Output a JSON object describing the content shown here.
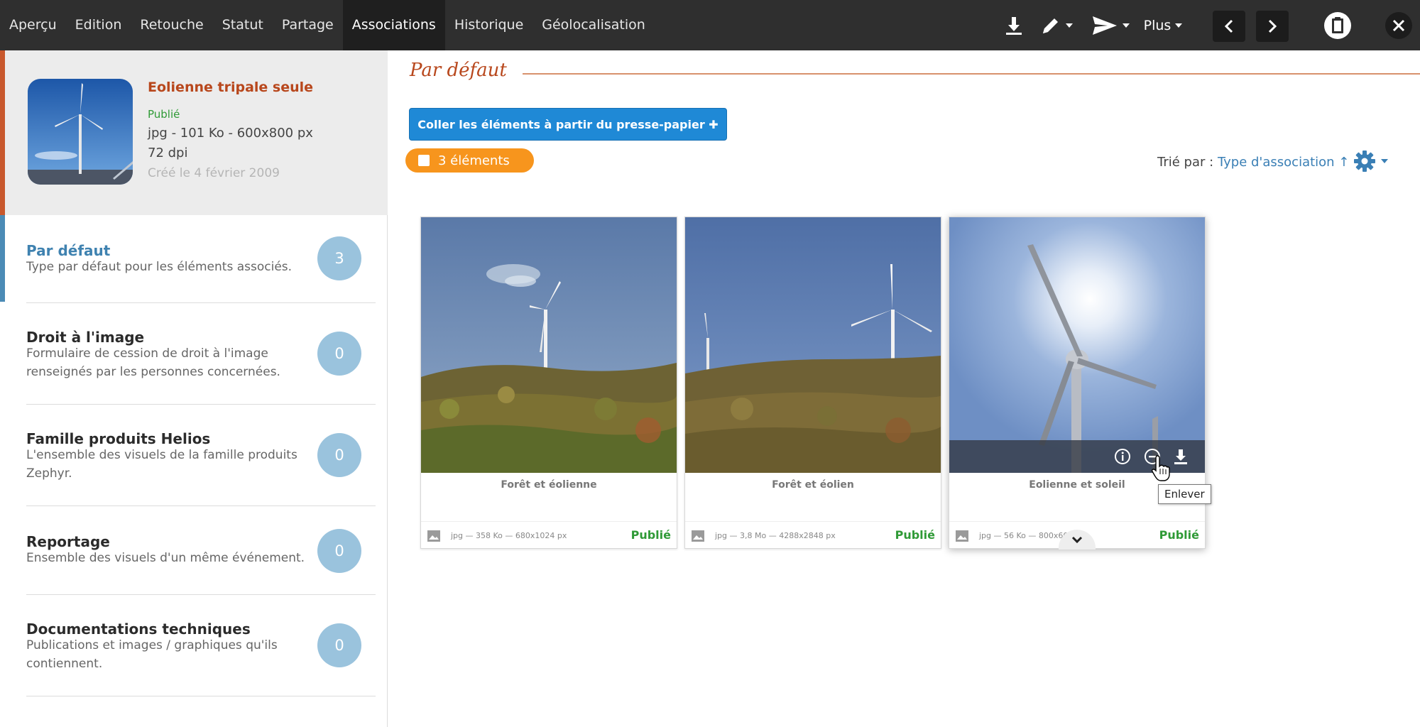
{
  "topbar": {
    "tabs": [
      {
        "label": "Aperçu"
      },
      {
        "label": "Edition"
      },
      {
        "label": "Retouche"
      },
      {
        "label": "Statut"
      },
      {
        "label": "Partage"
      },
      {
        "label": "Associations",
        "active": true
      },
      {
        "label": "Historique"
      },
      {
        "label": "Géolocalisation"
      }
    ],
    "more_label": "Plus",
    "icons": [
      "download-icon",
      "pencil-icon",
      "send-icon",
      "chevron-left-icon",
      "chevron-right-icon",
      "clipboard-icon",
      "close-icon"
    ]
  },
  "asset": {
    "title": "Eolienne tripale seule",
    "status": "Publié",
    "meta_format": "jpg - 101 Ko - 600x800 px",
    "meta_dpi": "72 dpi",
    "created": "Créé le 4 février 2009"
  },
  "categories": [
    {
      "name": "Par défaut",
      "desc": "Type par défaut pour les éléments associés.",
      "count": "3",
      "active": true
    },
    {
      "name": "Droit à l'image",
      "desc": "Formulaire de cession de droit à l'image renseignés par les personnes concernées.",
      "count": "0"
    },
    {
      "name": "Famille produits Helios",
      "desc": "L'ensemble des visuels de la famille produits Zephyr.",
      "count": "0"
    },
    {
      "name": "Reportage",
      "desc": "Ensemble des visuels d'un même événement.",
      "count": "0"
    },
    {
      "name": "Documentations techniques",
      "desc": "Publications et images / graphiques qu'ils contiennent.",
      "count": "0"
    }
  ],
  "main": {
    "section_title": "Par défaut",
    "paste_button": "Coller les éléments à partir du presse-papier ✚",
    "count_label": "3 éléments",
    "sort_prefix": "Trié par :",
    "sort_value": "Type d'association ↑"
  },
  "cards": [
    {
      "title": "Forêt et éolienne",
      "meta": "jpg — 358 Ko — 680x1024 px",
      "status": "Publié"
    },
    {
      "title": "Forêt et éolien",
      "meta": "jpg — 3,8 Mo — 4288x2848 px",
      "status": "Publié"
    },
    {
      "title": "Eolienne et soleil",
      "meta": "jpg — 56 Ko — 800x600 px",
      "status": "Publié",
      "hovered": true
    }
  ],
  "tooltip": "Enlever",
  "colors": {
    "topbar": "#2f2f2f",
    "accent_orange": "#c8582d",
    "accent_blue": "#1f89d6",
    "pill_orange": "#f7951d",
    "status_green": "#2f9a36",
    "badge_blue": "#9ac3dd"
  }
}
